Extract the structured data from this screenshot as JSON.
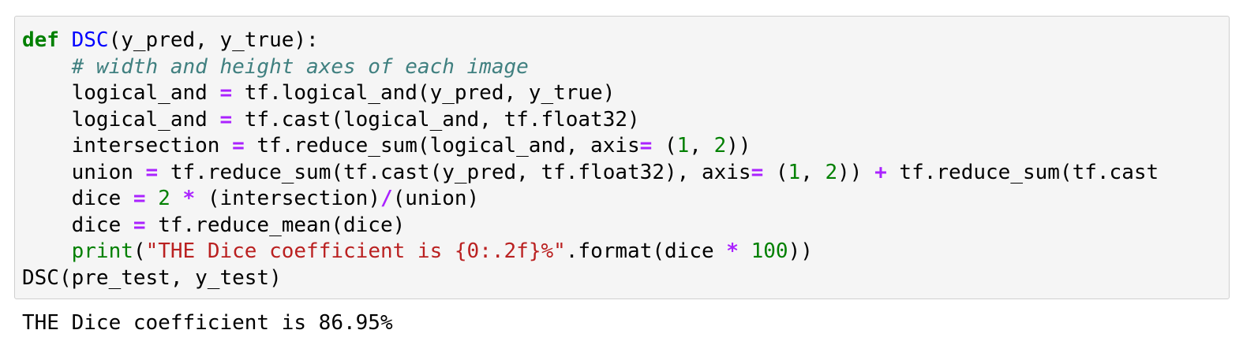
{
  "colors": {
    "keyword": "#008000",
    "function_name": "#0000ff",
    "comment": "#408080",
    "operator": "#aa22ff",
    "number": "#008000",
    "builtin": "#008000",
    "string": "#ba2121",
    "cell_background": "#f5f5f5",
    "cell_border": "#cfcfcf"
  },
  "code_lines": [
    [
      {
        "t": "def",
        "k": "kw"
      },
      {
        "t": " ",
        "k": "p"
      },
      {
        "t": "DSC",
        "k": "fn"
      },
      {
        "t": "(y_pred, y_true):",
        "k": "p"
      }
    ],
    [
      {
        "t": "    ",
        "k": "p"
      },
      {
        "t": "# width and height axes of each image",
        "k": "cm"
      }
    ],
    [
      {
        "t": "    logical_and ",
        "k": "p"
      },
      {
        "t": "=",
        "k": "op"
      },
      {
        "t": " tf.logical_and(y_pred, y_true)",
        "k": "p"
      }
    ],
    [
      {
        "t": "    logical_and ",
        "k": "p"
      },
      {
        "t": "=",
        "k": "op"
      },
      {
        "t": " tf.cast(logical_and, tf.float32)",
        "k": "p"
      }
    ],
    [
      {
        "t": "    intersection ",
        "k": "p"
      },
      {
        "t": "=",
        "k": "op"
      },
      {
        "t": " tf.reduce_sum(logical_and, axis",
        "k": "p"
      },
      {
        "t": "=",
        "k": "op"
      },
      {
        "t": " (",
        "k": "p"
      },
      {
        "t": "1",
        "k": "num"
      },
      {
        "t": ", ",
        "k": "p"
      },
      {
        "t": "2",
        "k": "num"
      },
      {
        "t": "))",
        "k": "p"
      }
    ],
    [
      {
        "t": "    union ",
        "k": "p"
      },
      {
        "t": "=",
        "k": "op"
      },
      {
        "t": " tf.reduce_sum(tf.cast(y_pred, tf.float32), axis",
        "k": "p"
      },
      {
        "t": "=",
        "k": "op"
      },
      {
        "t": " (",
        "k": "p"
      },
      {
        "t": "1",
        "k": "num"
      },
      {
        "t": ", ",
        "k": "p"
      },
      {
        "t": "2",
        "k": "num"
      },
      {
        "t": ")) ",
        "k": "p"
      },
      {
        "t": "+",
        "k": "op"
      },
      {
        "t": " tf.reduce_sum(tf.cast",
        "k": "p"
      }
    ],
    [
      {
        "t": "    dice ",
        "k": "p"
      },
      {
        "t": "=",
        "k": "op"
      },
      {
        "t": " ",
        "k": "p"
      },
      {
        "t": "2",
        "k": "num"
      },
      {
        "t": " ",
        "k": "p"
      },
      {
        "t": "*",
        "k": "op"
      },
      {
        "t": " (intersection)",
        "k": "p"
      },
      {
        "t": "/",
        "k": "op"
      },
      {
        "t": "(union)",
        "k": "p"
      }
    ],
    [
      {
        "t": "    dice ",
        "k": "p"
      },
      {
        "t": "=",
        "k": "op"
      },
      {
        "t": " tf.reduce_mean(dice)",
        "k": "p"
      }
    ],
    [
      {
        "t": "    ",
        "k": "p"
      },
      {
        "t": "print",
        "k": "bi"
      },
      {
        "t": "(",
        "k": "p"
      },
      {
        "t": "\"THE Dice coefficient is {0:.2f}%\"",
        "k": "str"
      },
      {
        "t": ".format(dice ",
        "k": "p"
      },
      {
        "t": "*",
        "k": "op"
      },
      {
        "t": " ",
        "k": "p"
      },
      {
        "t": "100",
        "k": "num"
      },
      {
        "t": "))",
        "k": "p"
      }
    ],
    [
      {
        "t": "DSC(pre_test, y_test)",
        "k": "p"
      }
    ]
  ],
  "output_text": "THE Dice coefficient is 86.95%"
}
